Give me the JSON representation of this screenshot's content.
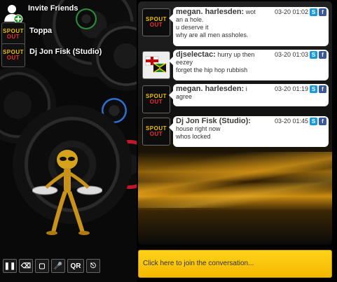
{
  "sidebar": {
    "invite_label": "Invite Friends",
    "users": [
      {
        "name": "Toppa",
        "avatar": "spout-out-logo"
      },
      {
        "name": "Dj Jon Fisk (Studio)",
        "avatar": "spout-out-logo"
      }
    ],
    "logo_line1": "SPOUT",
    "logo_line2": "OUT"
  },
  "controls": [
    {
      "name": "pause",
      "glyph": "❚❚"
    },
    {
      "name": "delete",
      "glyph": "⌫"
    },
    {
      "name": "window",
      "glyph": "▢"
    },
    {
      "name": "microphone",
      "glyph": "🎤"
    },
    {
      "name": "qr",
      "glyph": "QR"
    },
    {
      "name": "exit",
      "glyph": "⎋"
    }
  ],
  "messages": [
    {
      "user": "megan. harlesden:",
      "text_lines": [
        "wot",
        "an a hole.",
        "u deserve it",
        "why are all men assholes."
      ],
      "time": "03-20 01:02",
      "avatar": "spout-out-logo"
    },
    {
      "user": "djselectac:",
      "text_lines": [
        "hurry up then",
        "eezey",
        "forget the hip hop rubbish"
      ],
      "time": "03-20 01:03",
      "avatar": "flags"
    },
    {
      "user": "megan. harlesden:",
      "text_lines": [
        "i",
        "agree"
      ],
      "time": "03-20 01:19",
      "avatar": "spout-out-logo"
    },
    {
      "user": "Dj Jon Fisk (Studio):",
      "text_lines": [
        "",
        "house right now",
        "whos locked"
      ],
      "time": "03-20 01:45",
      "avatar": "spout-out-logo"
    }
  ],
  "join_label": "Click here to join the conversation...",
  "colors": {
    "accent": "#f5b800",
    "skype": "#1a9ad6",
    "facebook": "#3b5998"
  }
}
